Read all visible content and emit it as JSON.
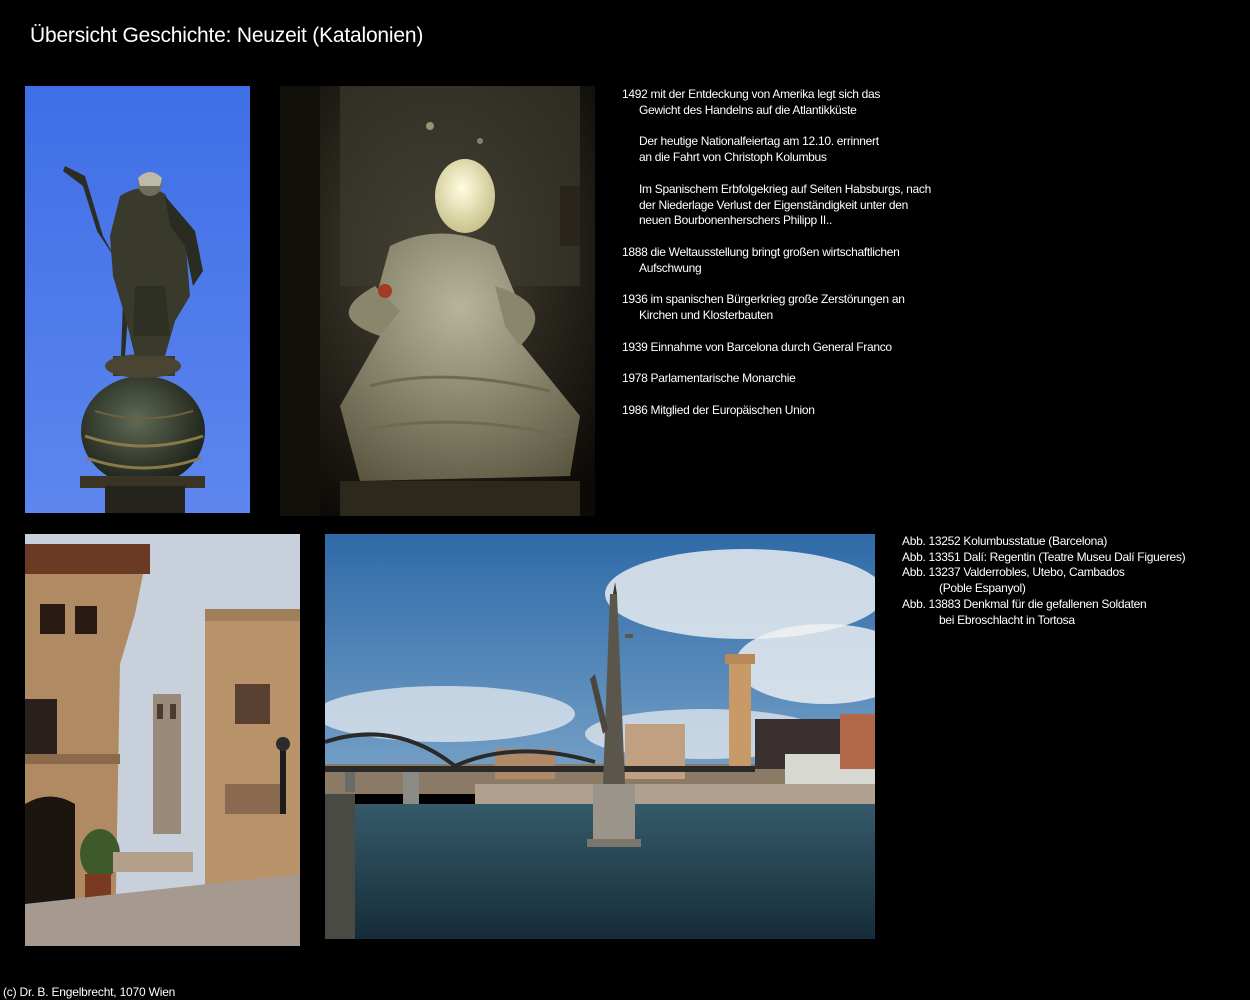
{
  "page": {
    "title": "Übersicht Geschichte: Neuzeit (Katalonien)"
  },
  "history": [
    {
      "lines": [
        "1492 mit der Entdeckung von Amerika legt sich das",
        "Gewicht des Handelns auf die Atlantikküste"
      ]
    },
    {
      "lines": [
        "Der heutige Nationalfeiertag am 12.10. errinnert",
        "an die Fahrt von Christoph Kolumbus"
      ]
    },
    {
      "lines": [
        "Im Spanischem Erbfolgekrieg auf Seiten Habsburgs, nach",
        "der Niederlage Verlust der Eigenständigkeit unter den",
        "neuen Bourbonenherschers Philipp II.."
      ]
    },
    {
      "lines": [
        "1888 die Weltausstellung bringt großen wirtschaftlichen",
        "Aufschwung"
      ]
    },
    {
      "lines": [
        "1936 im spanischen Bürgerkrieg große Zerstörungen an",
        "Kirchen und Klosterbauten"
      ]
    },
    {
      "lines": [
        "1939 Einnahme von Barcelona durch General Franco"
      ]
    },
    {
      "lines": [
        "1978 Parlamentarische Monarchie"
      ]
    },
    {
      "lines": [
        "1986 Mitglied der Europäischen Union"
      ]
    }
  ],
  "captions": [
    {
      "line": "Abb. 13252 Kolumbusstatue (Barcelona)"
    },
    {
      "line": "Abb. 13351 Dalí: Regentin (Teatre Museu Dalí Figueres)"
    },
    {
      "line": "Abb. 13237 Valderrobles, Utebo, Cambados",
      "cont": "(Poble Espanyol)"
    },
    {
      "line": "Abb. 13883 Denkmal für die gefallenen Soldaten",
      "cont": "bei Ebroschlacht in Tortosa"
    }
  ],
  "footer": {
    "copyright": "(c) Dr. B. Engelbrecht, 1070 Wien"
  }
}
